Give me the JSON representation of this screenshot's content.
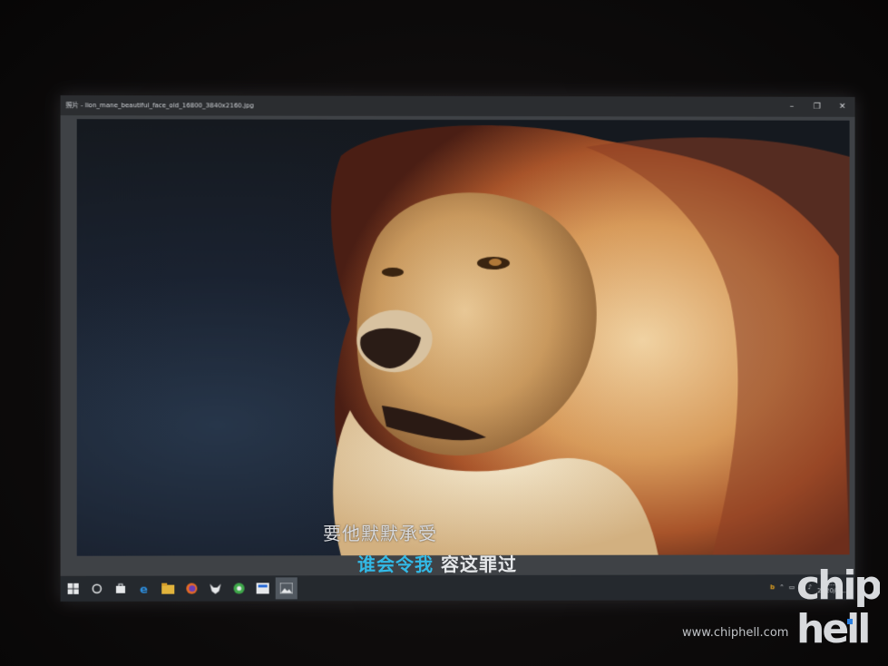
{
  "window": {
    "title": "照片 - lion_mane_beautiful_face_old_16800_3840x2160.jpg",
    "minimize": "–",
    "maximize": "❐",
    "close": "✕"
  },
  "lyrics": {
    "line1": "要他默默承受",
    "line2_highlight": "谁会令我",
    "line2_rest": " 容这罪过"
  },
  "taskbar": {
    "icons": [
      "windows-start-icon",
      "cortana-icon",
      "store-icon",
      "edge-icon",
      "file-explorer-icon",
      "firefox-icon",
      "app-fox-icon",
      "browser-icon",
      "calculator-icon",
      "photos-icon"
    ],
    "clock_time": "2:...",
    "clock_date": "2020/4/..."
  },
  "watermark": {
    "url": "www.chiphell.com",
    "logo_text": "chip hell"
  },
  "colors": {
    "lyric_highlight": "#32b9e6",
    "taskbar_bg": "#25292e"
  }
}
